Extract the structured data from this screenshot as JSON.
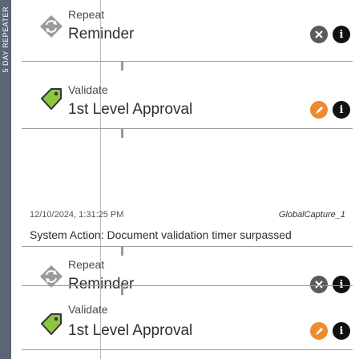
{
  "sidebar": {
    "label": "5 DAY REPEATER"
  },
  "timeline": [
    {
      "kicker": "Repeat",
      "title": "Reminder",
      "icon": "refresh-icon",
      "action": "cancel-icon",
      "action_color": "#5b5b5b"
    },
    {
      "kicker": "Validate",
      "title": "1st Level Approval",
      "icon": "tag-icon",
      "action": "approve-icon",
      "action_color": "#ee8a2f"
    },
    {
      "kicker": "Repeat",
      "title": "Reminder",
      "icon": "refresh-icon",
      "action": "cancel-icon",
      "action_color": "#5b5b5b"
    },
    {
      "kicker": "Validate",
      "title": "1st Level Approval",
      "icon": "tag-icon",
      "action": "approve-icon",
      "action_color": "#ee8a2f"
    }
  ],
  "system_event": {
    "date": "12/10/2024, 1:31:25 PM",
    "user": "GlobalCapture_1",
    "message": "System Action: Document validation timer surpassed"
  },
  "colors": {
    "rail": "#5c6575",
    "accent": "#ee8a2f",
    "lime": "#8dc63f"
  }
}
